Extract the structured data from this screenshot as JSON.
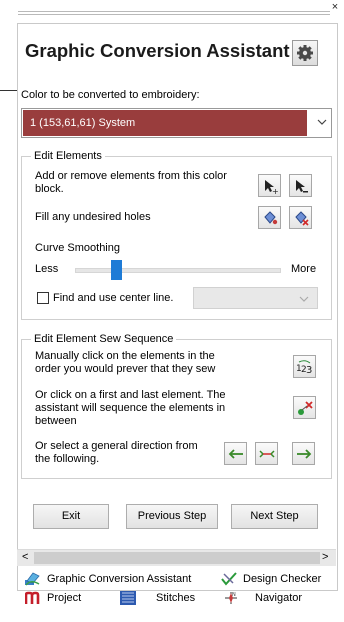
{
  "window": {
    "close_glyph": "×"
  },
  "header": {
    "title": "Graphic Conversion Assistant",
    "settings_icon": "gear-icon"
  },
  "color": {
    "label": "Color to be converted to embroidery:",
    "selected": "1   (153,61,61) System",
    "swatch": "#993d3d"
  },
  "edit_elements": {
    "legend": "Edit Elements",
    "add_remove_text": "Add or remove elements from this color block.",
    "fill_holes_text": "Fill any undesired holes",
    "curve_label": "Curve Smoothing",
    "less": "Less",
    "more": "More",
    "curve_level": 0.2,
    "center_line_label": "Find and use center line.",
    "center_line_checked": false
  },
  "sew_sequence": {
    "legend": "Edit Element Sew Sequence",
    "manual_text": "Manually click on the elements in the order you would prever that they sew",
    "first_last_text": "Or click on a first and last element. The assistant will sequence the elements in between",
    "direction_text": "Or select a general direction from the following."
  },
  "buttons": {
    "exit": "Exit",
    "previous": "Previous Step",
    "next": "Next Step"
  },
  "scroll": {
    "left": "<",
    "right": ">"
  },
  "tabs": {
    "row1": [
      {
        "label": "Graphic Conversion Assistant",
        "icon": "graphic-conversion-icon"
      },
      {
        "label": "Design Checker",
        "icon": "design-checker-icon"
      }
    ],
    "row2": [
      {
        "label": "Project",
        "icon": "project-icon"
      },
      {
        "label": "Stitches",
        "icon": "stitches-icon"
      },
      {
        "label": "Navigator",
        "icon": "navigator-icon"
      }
    ]
  }
}
